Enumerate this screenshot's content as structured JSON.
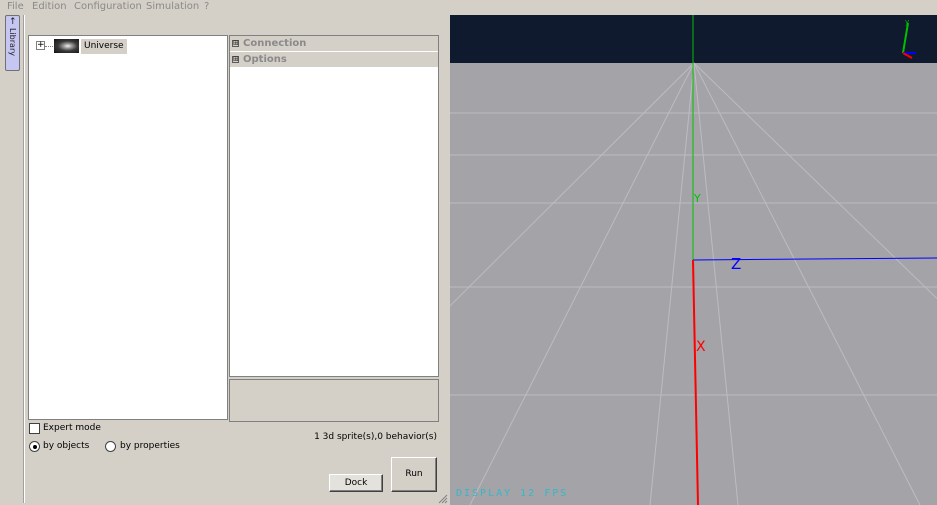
{
  "menu": {
    "items": [
      "File",
      "Edition",
      "Configuration",
      "Simulation",
      "?"
    ]
  },
  "library_tab": {
    "label": "Library",
    "arrow": "↑"
  },
  "tree": {
    "expander": "+",
    "root_label": "Universe"
  },
  "properties": {
    "sections": [
      "Connection",
      "Options"
    ],
    "expander": "⊞"
  },
  "options": {
    "expert_mode_label": "Expert mode",
    "expert_mode_checked": false,
    "view_by": [
      {
        "label": "by objects",
        "selected": true
      },
      {
        "label": "by properties",
        "selected": false
      }
    ]
  },
  "status": {
    "text": "1 3d sprite(s),0 behavior(s)"
  },
  "buttons": {
    "dock_label": "Dock",
    "run_label": "Run"
  },
  "viewport": {
    "axis_labels": {
      "x": "X",
      "y": "Y",
      "z": "Z"
    },
    "fps_text": "DISPLAY 12 FPS",
    "colors": {
      "sky": "#0f1a2e",
      "ground": "#a4a3a8",
      "x_axis": "#ff0000",
      "y_axis": "#00c000",
      "z_axis": "#0000ff",
      "fps": "#35b7c8"
    }
  }
}
